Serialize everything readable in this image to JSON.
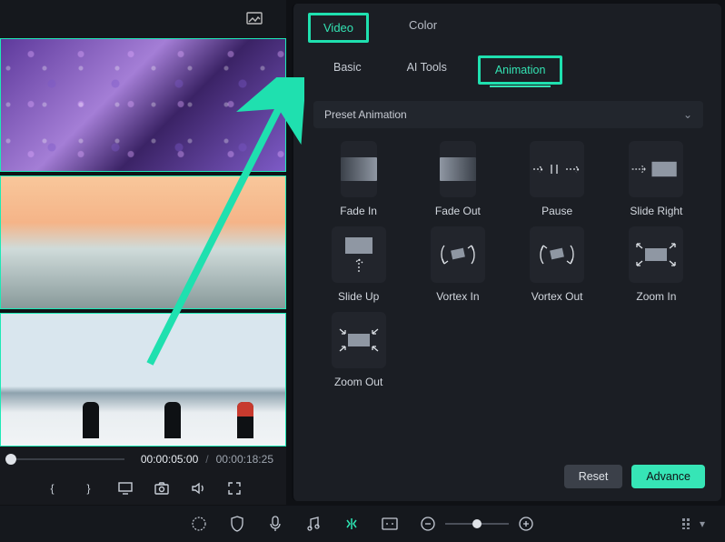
{
  "left": {
    "time_current": "00:00:05:00",
    "time_separator": "/",
    "time_total": "00:00:18:25",
    "controls": [
      "{",
      "}",
      "screen",
      "snapshot",
      "audio",
      "fullscreen"
    ]
  },
  "right": {
    "top_tabs": {
      "video": "Video",
      "color": "Color"
    },
    "sub_tabs": {
      "basic": "Basic",
      "ai": "AI Tools",
      "animation": "Animation"
    },
    "preset_label": "Preset Animation",
    "anims": [
      {
        "label": "Fade In"
      },
      {
        "label": "Fade Out"
      },
      {
        "label": "Pause"
      },
      {
        "label": "Slide Right"
      },
      {
        "label": "Slide Up"
      },
      {
        "label": "Vortex In"
      },
      {
        "label": "Vortex Out"
      },
      {
        "label": "Zoom In"
      },
      {
        "label": "Zoom Out"
      }
    ],
    "buttons": {
      "reset": "Reset",
      "advance": "Advance"
    }
  },
  "colors": {
    "accent": "#1fe0af",
    "panel": "#1b1e24",
    "bg": "#0f1115"
  }
}
